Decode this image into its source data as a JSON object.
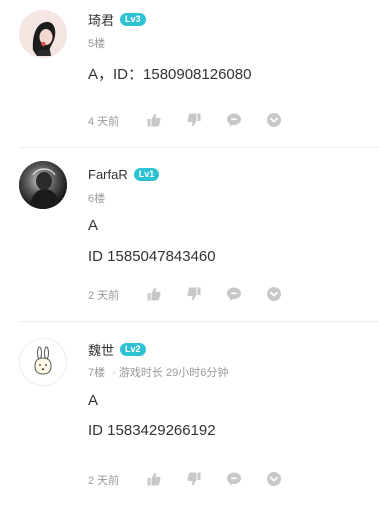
{
  "comments": [
    {
      "username": "琦君",
      "level": "Lv3",
      "floor": "5楼",
      "play_time": "",
      "lines": [
        "A，ID：1580908126080"
      ],
      "time": "4 天前"
    },
    {
      "username": "FarfaR",
      "level": "Lv1",
      "floor": "6楼",
      "play_time": "",
      "lines": [
        "A",
        "ID 1585047843460"
      ],
      "time": "2 天前"
    },
    {
      "username": "魏世",
      "level": "Lv2",
      "floor": "7楼",
      "play_time": "· 游戏时长 29小时6分钟",
      "lines": [
        "A",
        "ID 1583429266192"
      ],
      "time": "2 天前"
    }
  ],
  "colors": {
    "level_badge": "#2fc2d2",
    "icon": "#c8c8c8",
    "divider": "#ededed"
  },
  "icons": [
    "thumbs-up-icon",
    "thumbs-down-icon",
    "reply-bubble-icon",
    "more-chevron-icon"
  ]
}
